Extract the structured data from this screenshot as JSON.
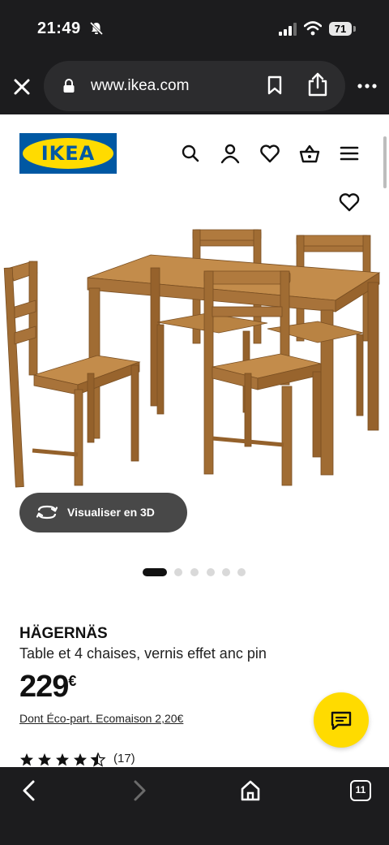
{
  "status_bar": {
    "time": "21:49",
    "battery": "71"
  },
  "browser": {
    "url": "www.ikea.com",
    "tab_count": "11"
  },
  "header": {
    "logo_text": "IKEA",
    "icons": [
      "search-icon",
      "account-icon",
      "wishlist-icon",
      "basket-icon",
      "menu-icon"
    ]
  },
  "product": {
    "visualize_label": "Visualiser en 3D",
    "carousel": {
      "total": 6,
      "active": 1
    },
    "name": "HÄGERNÄS",
    "description": "Table et 4 chaises, vernis effet anc pin",
    "price_integer": "229",
    "price_currency": "€",
    "eco_participation": "Dont Éco-part. Ecomaison 2,20€",
    "rating": 4.5,
    "review_count": "(17)"
  },
  "colors": {
    "ikea_blue": "#0058a3",
    "ikea_yellow": "#ffdb00",
    "dark_bar": "#1c1c1e",
    "wood": "#b07a3e"
  }
}
